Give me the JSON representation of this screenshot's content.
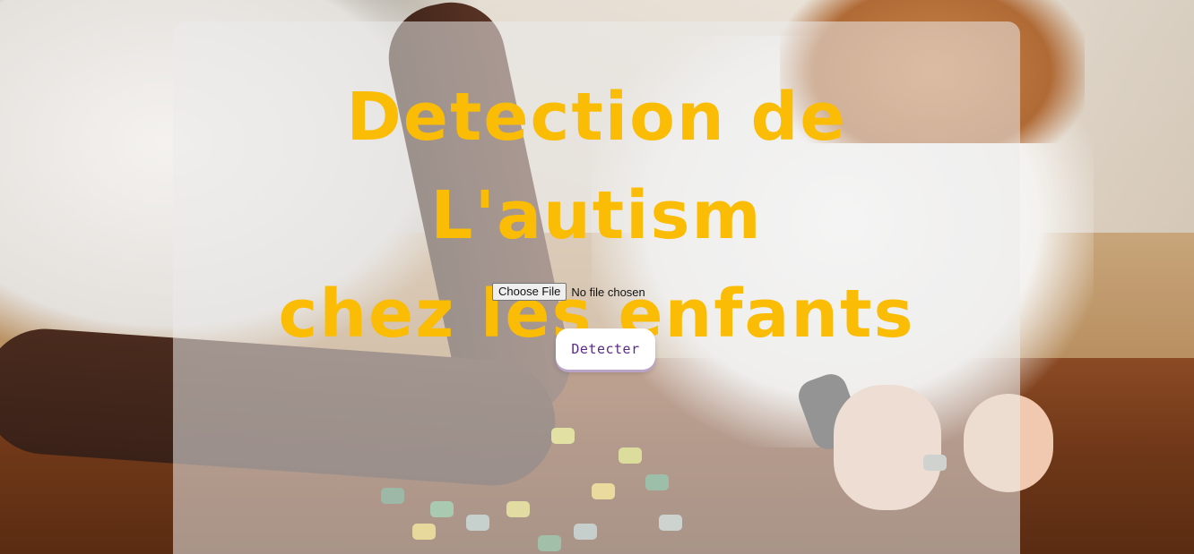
{
  "page": {
    "title_line1": "Detection de L'autism",
    "title_line2": "chez les enfants",
    "background": "background-photo"
  },
  "upload": {
    "button_label": "Choose File",
    "status_text": "No file chosen"
  },
  "actions": {
    "detect_label": "Detecter"
  },
  "colors": {
    "title": "#fbbc05",
    "button_text": "#5b2a86"
  }
}
